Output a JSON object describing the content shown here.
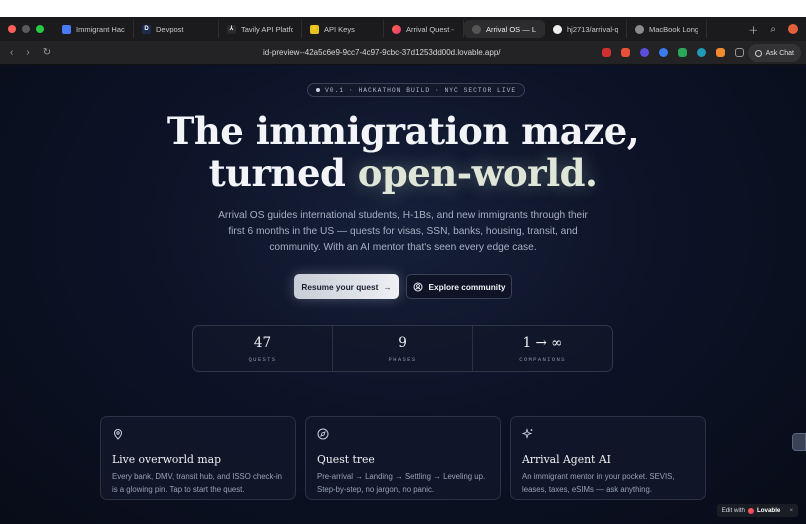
{
  "browser": {
    "tabs": [
      {
        "label": "Immigrant Hackat",
        "color": "#4a7bf7",
        "glyph": ""
      },
      {
        "label": "Devpost",
        "color": "#1d2b4f",
        "glyph": "D"
      },
      {
        "label": "Tavily API Platform",
        "color": "#2a2a2a",
        "glyph": "⅄"
      },
      {
        "label": "API Keys",
        "color": "#e8c21c",
        "glyph": "⚡"
      },
      {
        "label": "Arrival Quest - Lov",
        "color": "#e3367b",
        "glyph": ""
      },
      {
        "label": "Arrival OS — Land",
        "color": "#555",
        "glyph": ""
      },
      {
        "label": "hj2713/arrival-que",
        "color": "#111",
        "glyph": ""
      },
      {
        "label": "MacBook Long Pag",
        "color": "#6b6b6b",
        "glyph": ""
      }
    ],
    "active_tab": 5,
    "url": "id-preview--42a5c6e9-9cc7-4c97-9cbc-37d1253dd00d.lovable.app/",
    "ask_chat_label": "Ask Chat"
  },
  "hero": {
    "badge": "V0.1 · HACKATHON BUILD · NYC SECTOR LIVE",
    "title_line1": "The immigration maze,",
    "title_line2_pre": "turned ",
    "title_line2_accent": "open-world.",
    "subtitle": "Arrival OS guides international students, H-1Bs, and new immigrants through their first 6 months in the US — quests for visas, SSN, banks, housing, transit, and community. With an AI mentor that's seen every edge case.",
    "primary_button": "Resume your quest",
    "secondary_button": "Explore community"
  },
  "stats": [
    {
      "value": "47",
      "label": "QUESTS"
    },
    {
      "value": "9",
      "label": "PHASES"
    },
    {
      "value": "1 → ∞",
      "label": "COMPANIONS"
    }
  ],
  "features": [
    {
      "icon": "map-pin-icon",
      "title": "Live overworld map",
      "desc": "Every bank, DMV, transit hub, and ISSO check-in is a glowing pin. Tap to start the quest."
    },
    {
      "icon": "compass-icon",
      "title": "Quest tree",
      "desc": "Pre-arrival → Landing → Settling → Leveling up. Step-by-step, no jargon, no panic."
    },
    {
      "icon": "sparkles-icon",
      "title": "Arrival Agent AI",
      "desc": "An immigrant mentor in your pocket. SEVIS, leases, taxes, eSIMs — ask anything."
    }
  ],
  "lovable": {
    "prefix": "Edit with",
    "brand": "Lovable",
    "close": "×"
  },
  "colors": {
    "background": "#0b1020",
    "accent_glow": "#dfe6d8",
    "primary_button": "#e4e7ee"
  }
}
